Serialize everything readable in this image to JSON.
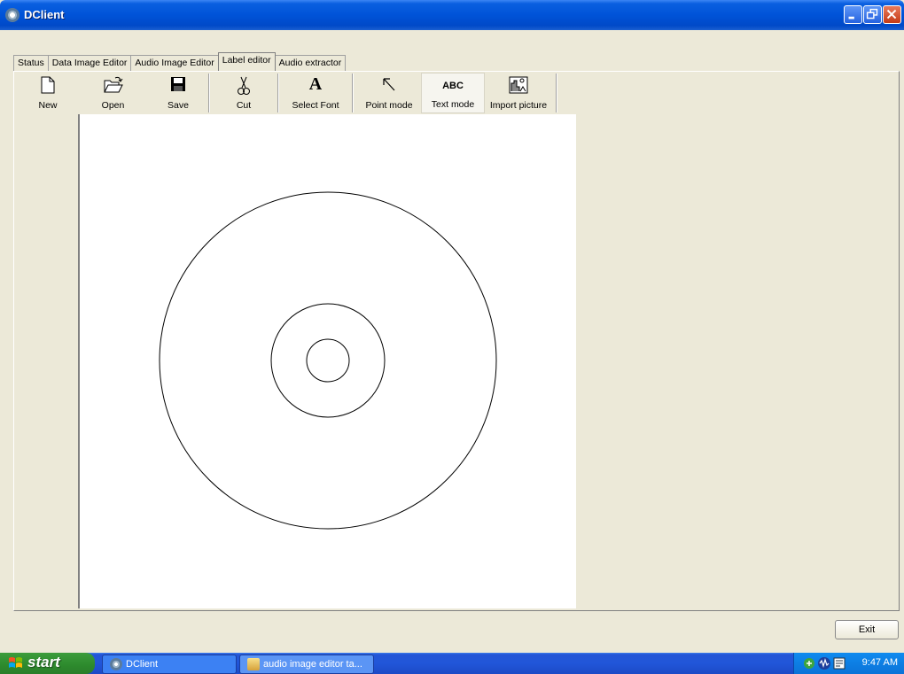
{
  "window": {
    "title": "DClient"
  },
  "tabs": [
    {
      "label": "Status",
      "active": false
    },
    {
      "label": "Data Image Editor",
      "active": false
    },
    {
      "label": "Audio Image Editor",
      "active": false
    },
    {
      "label": "Label editor",
      "active": true
    },
    {
      "label": "Audio extractor",
      "active": false
    }
  ],
  "toolbar": {
    "new_label": "New",
    "open_label": "Open",
    "save_label": "Save",
    "cut_label": "Cut",
    "select_font_label": "Select Font",
    "point_mode_label": "Point mode",
    "text_mode_label": "Text mode",
    "import_picture_label": "Import picture",
    "text_mode_icon_text": "ABC",
    "select_font_icon_text": "A"
  },
  "buttons": {
    "exit_label": "Exit"
  },
  "taskbar": {
    "start_label": "start",
    "tasks": [
      {
        "label": "DClient"
      },
      {
        "label": "audio image editor ta..."
      }
    ],
    "clock": "9:47 AM"
  },
  "colors": {
    "titlebar": "#0053d8",
    "taskbar": "#2156d9",
    "start": "#2d8a2d",
    "face": "#ece9d8"
  }
}
